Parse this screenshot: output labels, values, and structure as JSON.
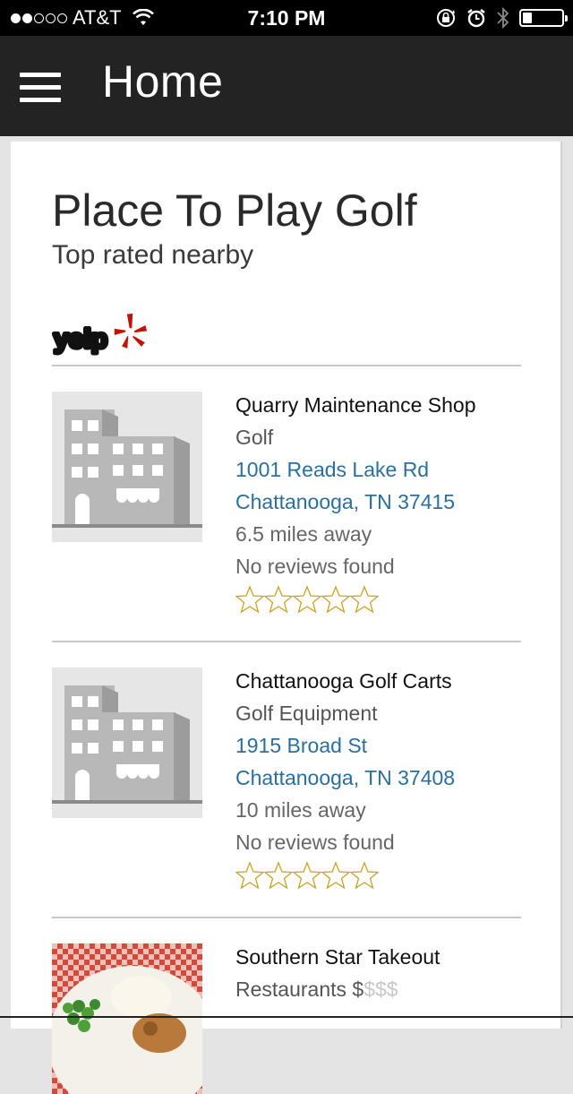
{
  "status_bar": {
    "carrier": "AT&T",
    "signal_dots_filled": 2,
    "signal_dots_total": 5,
    "time": "7:10 PM",
    "battery_level": 0.2,
    "icons": [
      "wifi-icon",
      "rotation-lock-icon",
      "alarm-icon",
      "bluetooth-icon",
      "battery-icon"
    ]
  },
  "nav": {
    "menu_icon": "hamburger-menu-icon",
    "title": "Home"
  },
  "card": {
    "title": "Place To Play Golf",
    "subtitle": "Top rated nearby",
    "provider_logo": "yelp"
  },
  "listings": [
    {
      "name": "Quarry Maintenance Shop",
      "category": "Golf",
      "address_line1": "1001 Reads Lake Rd",
      "address_line2": "Chattanooga, TN 37415",
      "distance": "6.5 miles away",
      "reviews": "No reviews found",
      "rating": 0,
      "thumbnail": "building-placeholder-icon"
    },
    {
      "name": "Chattanooga Golf Carts",
      "category": "Golf Equipment",
      "address_line1": "1915 Broad St",
      "address_line2": "Chattanooga, TN 37408",
      "distance": "10 miles away",
      "reviews": "No reviews found",
      "rating": 0,
      "thumbnail": "building-placeholder-icon"
    },
    {
      "name": "Southern Star Takeout",
      "category": "Restaurants",
      "price_active": "$",
      "price_inactive": "$$$",
      "thumbnail": "food-photo"
    }
  ],
  "colors": {
    "nav_bg": "#232323",
    "link": "#2a6fa0",
    "star_outline": "#c9a227",
    "yelp_red": "#c41200"
  }
}
